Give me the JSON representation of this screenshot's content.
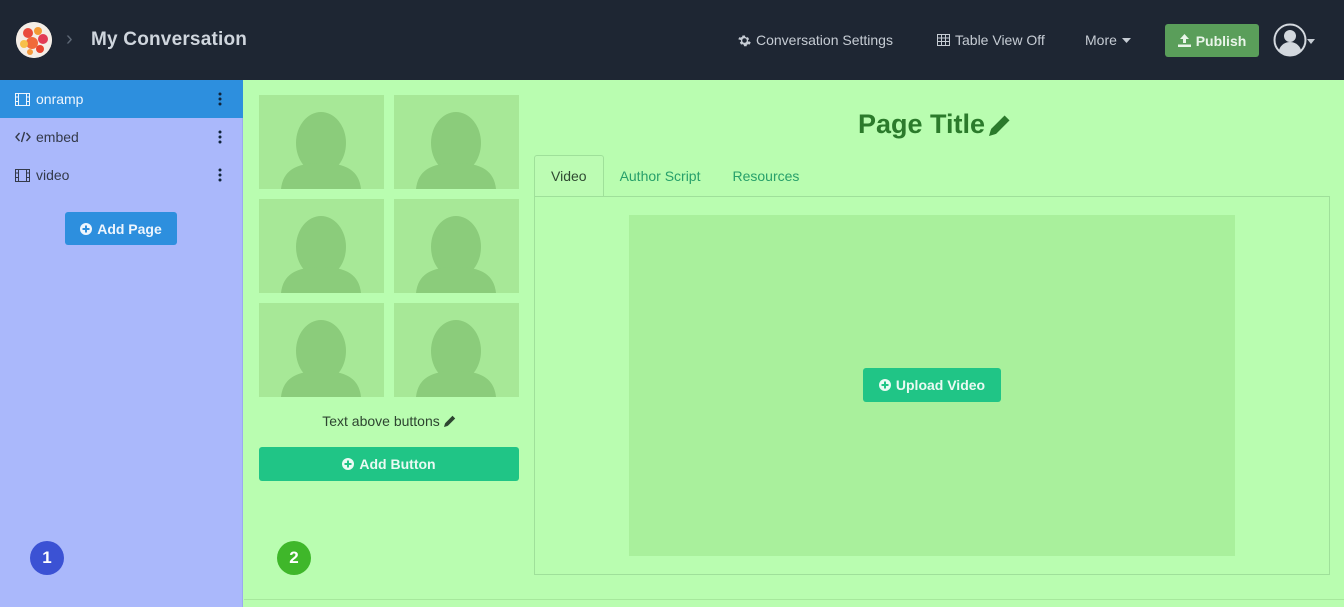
{
  "header": {
    "separator": "›",
    "title": "My Conversation",
    "nav": {
      "conversation_settings": "Conversation Settings",
      "table_view": "Table View Off",
      "more": "More"
    },
    "publish_label": "Publish"
  },
  "sidebar": {
    "items": [
      {
        "label": "onramp",
        "icon": "film-icon",
        "active": true
      },
      {
        "label": "embed",
        "icon": "code-icon",
        "active": false
      },
      {
        "label": "video",
        "icon": "film-icon",
        "active": false
      }
    ],
    "add_page_label": "Add Page",
    "badge": "1"
  },
  "content": {
    "thumbnails_count_icon": "person-placeholder-icon",
    "text_above_buttons": "Text above buttons",
    "add_button_label": "Add Button",
    "badge": "2",
    "page_title": "Page Title",
    "tabs": [
      {
        "label": "Video",
        "active": true
      },
      {
        "label": "Author Script",
        "active": false
      },
      {
        "label": "Resources",
        "active": false
      }
    ],
    "upload_video_label": "Upload Video"
  },
  "colors": {
    "header_bg": "#1e2633",
    "sidebar_bg": "#aab8fb",
    "active_item": "#2d8fde",
    "content_bg": "#b9fdb0",
    "accent_green": "#20c586",
    "publish_green": "#5a9e5a",
    "title_green": "#2b7a2b"
  }
}
